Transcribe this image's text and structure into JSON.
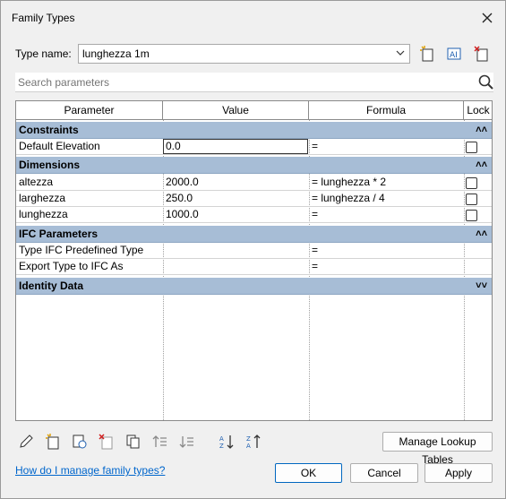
{
  "window": {
    "title": "Family Types"
  },
  "type_name": {
    "label": "Type name:",
    "value": "lunghezza 1m"
  },
  "search": {
    "placeholder": "Search parameters"
  },
  "columns": [
    "Parameter",
    "Value",
    "Formula",
    "Lock"
  ],
  "groups": [
    {
      "name": "Constraints",
      "collapsed": false
    },
    {
      "name": "Dimensions",
      "collapsed": false
    },
    {
      "name": "IFC Parameters",
      "collapsed": false
    },
    {
      "name": "Identity Data",
      "collapsed": true
    }
  ],
  "rows": {
    "default_elevation": {
      "param": "Default Elevation",
      "value": "0.0",
      "formula": "="
    },
    "altezza": {
      "param": "altezza",
      "value": "2000.0",
      "formula": "= lunghezza * 2"
    },
    "larghezza": {
      "param": "larghezza",
      "value": "250.0",
      "formula": "= lunghezza / 4"
    },
    "lunghezza": {
      "param": "lunghezza",
      "value": "1000.0",
      "formula": "="
    },
    "ifc_predefined": {
      "param": "Type IFC Predefined Type",
      "value": "",
      "formula": "="
    },
    "ifc_export_as": {
      "param": "Export Type to IFC As",
      "value": "",
      "formula": "="
    }
  },
  "buttons": {
    "manage_lookup": "Manage Lookup Tables",
    "ok": "OK",
    "cancel": "Cancel",
    "apply": "Apply"
  },
  "help_link": "How do I manage family types?",
  "colors": {
    "group_header": "#a7bdd6",
    "link": "#0066cc",
    "primary_border": "#0067c0"
  }
}
